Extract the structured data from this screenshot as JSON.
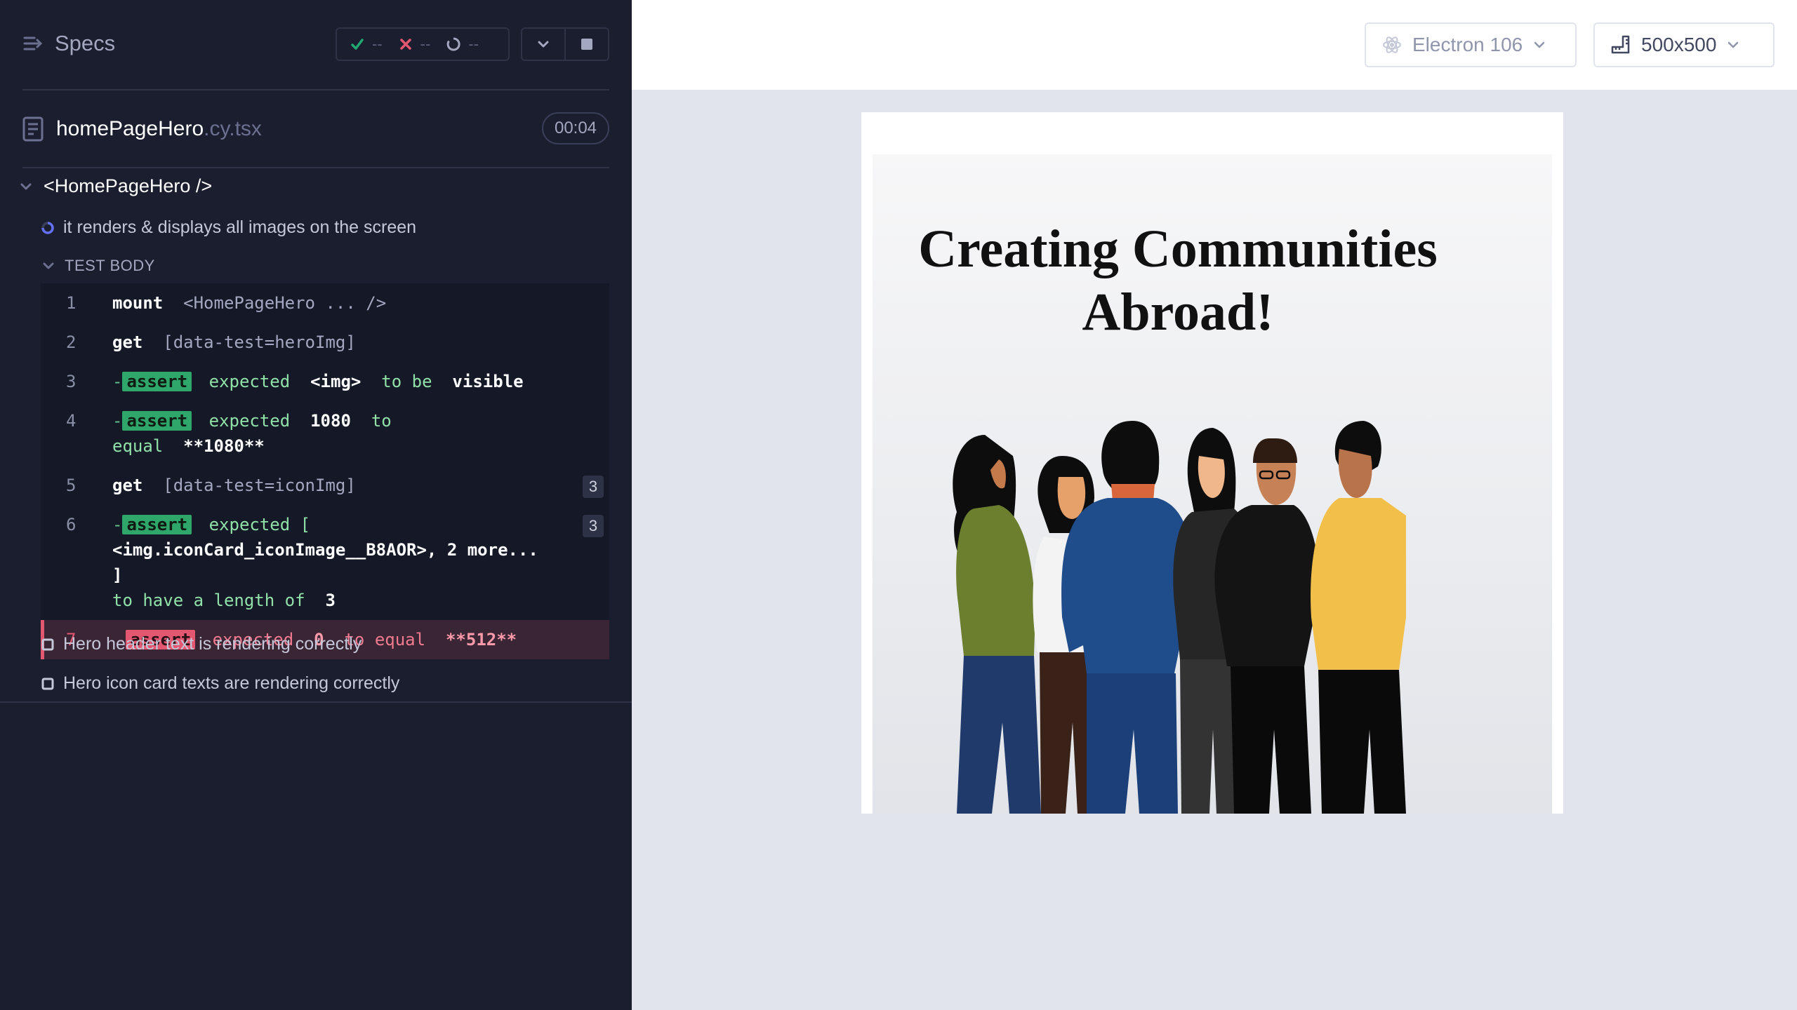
{
  "reporter": {
    "specs_label": "Specs",
    "stats": {
      "passed": "--",
      "failed": "--",
      "pending": "--"
    },
    "spec_file": {
      "name": "homePageHero",
      "ext": ".cy.tsx",
      "duration": "00:04"
    },
    "suite_title": "<HomePageHero />",
    "tests": [
      {
        "title": "it renders & displays all images on the screen",
        "state": "running"
      },
      {
        "title": "Hero header text is rendering correctly",
        "state": "pending"
      },
      {
        "title": "Hero icon card texts are rendering correctly",
        "state": "pending"
      }
    ],
    "test_body_label": "TEST BODY",
    "commands": [
      {
        "num": "1",
        "name": "mount",
        "message": "<HomePageHero ... />"
      },
      {
        "num": "2",
        "name": "get",
        "message": "[data-test=heroImg]"
      },
      {
        "num": "3",
        "badge": "assert",
        "parts": [
          "expected",
          "<img>",
          "to be",
          "visible"
        ]
      },
      {
        "num": "4",
        "badge": "assert",
        "parts": [
          "expected",
          "1080",
          "to equal",
          "**1080**"
        ]
      },
      {
        "num": "5",
        "name": "get",
        "message": "[data-test=iconImg]",
        "count": "3"
      },
      {
        "num": "6",
        "badge": "assert",
        "line1": "expected  [",
        "line2": "<img.iconCard_iconImage__B8AOR>, 2 more... ]",
        "line3a": "to have a length of",
        "line3b": "3",
        "count": "3"
      },
      {
        "num": "7",
        "badge": "assert",
        "parts": [
          "expected",
          "0",
          "to equal",
          "**512**"
        ],
        "state": "failed"
      }
    ]
  },
  "aut": {
    "browser_label": "Electron 106",
    "viewport_label": "500x500",
    "hero_title": "Creating Communities Abroad!"
  },
  "colors": {
    "reporter_bg": "#1b1e2e",
    "passed": "#1fa971",
    "failed": "#e45770",
    "running": "#6470f3",
    "aut_bg": "#e1e3ed"
  }
}
